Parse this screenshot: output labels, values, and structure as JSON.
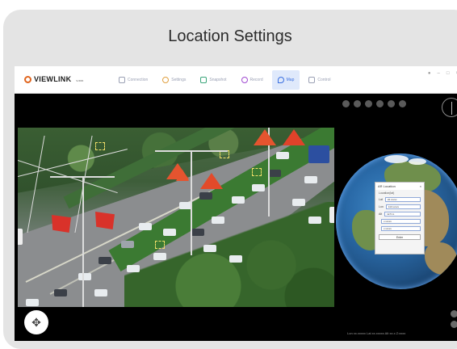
{
  "frame": {
    "title": "Location Settings"
  },
  "app": {
    "logo": {
      "text": "VIEWLINK",
      "version": "v.xxx"
    },
    "nav": [
      {
        "label": "Connection",
        "icon": "connection-icon",
        "active": false
      },
      {
        "label": "Settings",
        "icon": "settings-icon",
        "active": false
      },
      {
        "label": "Snapshot",
        "icon": "snapshot-icon",
        "active": false
      },
      {
        "label": "Record",
        "icon": "record-icon",
        "active": false
      },
      {
        "label": "Map",
        "icon": "map-icon",
        "active": true
      },
      {
        "label": "Control",
        "icon": "control-icon",
        "active": false
      }
    ],
    "window_controls": [
      "user-icon",
      "minimize-icon",
      "maximize-icon",
      "close-icon"
    ]
  },
  "dialog": {
    "title": "AR Location",
    "subtitle": "Location(lat)",
    "fields": [
      {
        "label": "Lat",
        "value": "22.xxxxx"
      },
      {
        "label": "Lon",
        "value": "113.xxxxx"
      },
      {
        "label": "Alt",
        "value": "12.5 m"
      },
      {
        "label": "",
        "value": "x.xxxxx"
      },
      {
        "label": "",
        "value": "x.xxxxx"
      }
    ],
    "button": "Enter"
  },
  "status": {
    "coords": "Lon xx.xxxxx  Lat xx.xxxxx  Alt xx.x  Z:xxxx"
  },
  "colors": {
    "accent": "#3a6fe0",
    "logo": "#e0651e",
    "flag": "#d9322a"
  }
}
